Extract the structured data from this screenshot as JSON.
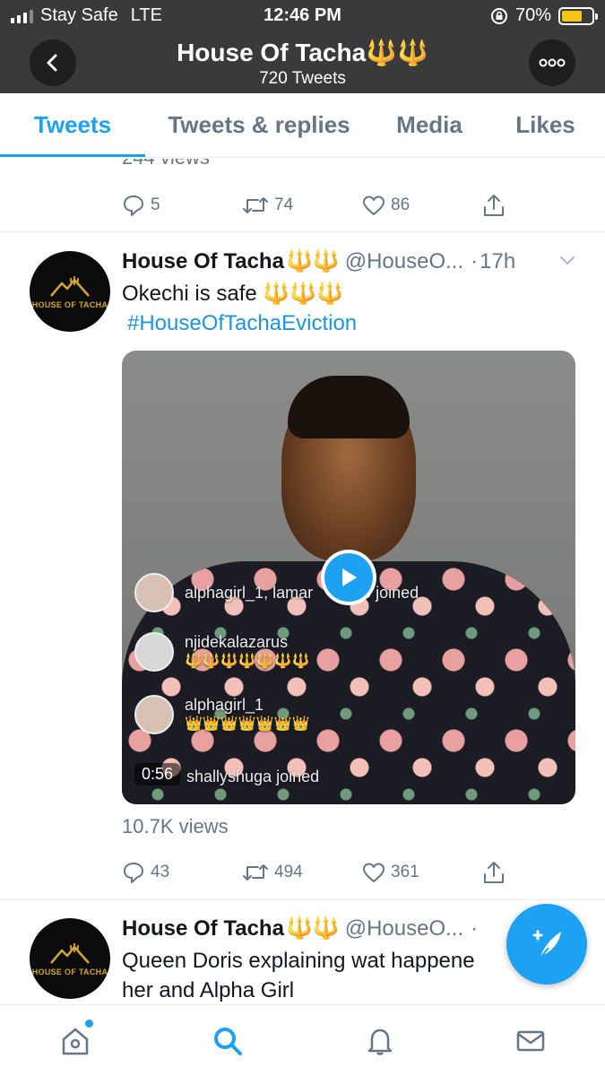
{
  "status_bar": {
    "carrier": "Stay Safe",
    "network": "LTE",
    "time": "12:46 PM",
    "battery_percent": "70%",
    "battery_level": 0.7,
    "signal_bars": 3
  },
  "header": {
    "profile_name": "House Of Tacha",
    "profile_emoji": "🔱🔱",
    "tweet_count": "720 Tweets",
    "back_icon": "chevron-left-icon",
    "more_icon": "more-horizontal-icon"
  },
  "tabs": [
    {
      "label": "Tweets",
      "active": true
    },
    {
      "label": "Tweets & replies",
      "active": false
    },
    {
      "label": "Media",
      "active": false
    },
    {
      "label": "Likes",
      "active": false
    }
  ],
  "prev_tweet": {
    "views": "244 views",
    "replies": "5",
    "retweets": "74",
    "likes": "86"
  },
  "tweet1": {
    "name": "House Of Tacha",
    "name_emoji": "🔱🔱",
    "handle": "@HouseO...",
    "dot": "·",
    "time_ago": "17h",
    "text": "Okechi is safe",
    "text_emoji": "🔱🔱🔱",
    "hashtag": "#HouseOfTachaEviction",
    "avatar_logo_text": "HOUSE OF TACHA",
    "media": {
      "overlay_1": "alphagirl_1, lamar",
      "overlay_1b": "1010 joined",
      "overlay_2_user": "njidekalazarus",
      "overlay_2_msg": "🔱🔱🔱🔱🔱🔱🔱",
      "overlay_3_user": "alphagirl_1",
      "overlay_3_msg": "👑👑👑👑👑👑👑",
      "overlay_4": "shallyshuga joined",
      "duration": "0:56"
    },
    "views": "10.7K views",
    "replies": "43",
    "retweets": "494",
    "likes": "361"
  },
  "tweet2": {
    "name": "House Of Tacha",
    "name_emoji": "🔱🔱",
    "handle": "@HouseO...",
    "dot": "·",
    "text_line1": "Queen Doris explaining wat happene",
    "text_line2": "her and Alpha Girl",
    "avatar_logo_text": "HOUSE OF TACHA"
  },
  "colors": {
    "accent": "#1da1f2",
    "header_bg": "#3a3a3a",
    "muted": "#657786"
  },
  "bottom_nav": [
    {
      "icon": "home-icon",
      "notification_dot": true
    },
    {
      "icon": "search-icon",
      "active": true
    },
    {
      "icon": "bell-icon"
    },
    {
      "icon": "mail-icon"
    }
  ]
}
